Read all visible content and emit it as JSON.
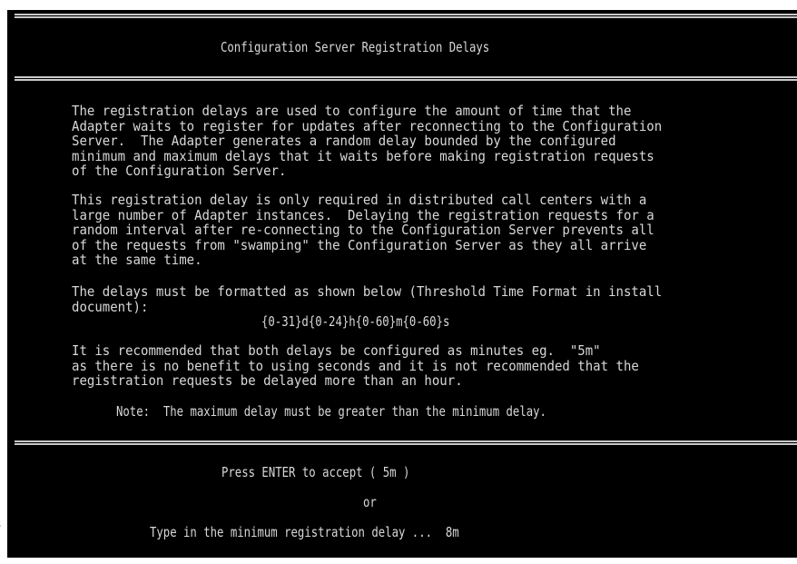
{
  "screen": {
    "title": "Configuration Server Registration Delays",
    "paragraph1": [
      "The registration delays are used to configure the amount of time that the",
      "Adapter waits to register for updates after reconnecting to the Configuration",
      "Server.  The Adapter generates a random delay bounded by the configured",
      "minimum and maximum delays that it waits before making registration requests",
      "of the Configuration Server."
    ],
    "paragraph2": [
      "This registration delay is only required in distributed call centers with a",
      "large number of Adapter instances.  Delaying the registration requests for a",
      "random interval after re-connecting to the Configuration Server prevents all",
      "of the requests from \"swamping\" the Configuration Server as they all arrive",
      "at the same time."
    ],
    "paragraph3": [
      "The delays must be formatted as shown below (Threshold Time Format in install",
      "document):"
    ],
    "format": "{0-31}d{0-24}h{0-60}m{0-60}s",
    "paragraph4": [
      "It is recommended that both delays be configured as minutes eg.  \"5m\"",
      "as there is no benefit to using seconds and it is not recommended that the",
      "registration requests be delayed more than an hour."
    ],
    "note": "Note:  The maximum delay must be greater than the minimum delay.",
    "prompt_accept": "Press ENTER to accept ( 5m )",
    "prompt_or": "or",
    "prompt_type": "Type in the minimum registration delay ...  8m"
  }
}
